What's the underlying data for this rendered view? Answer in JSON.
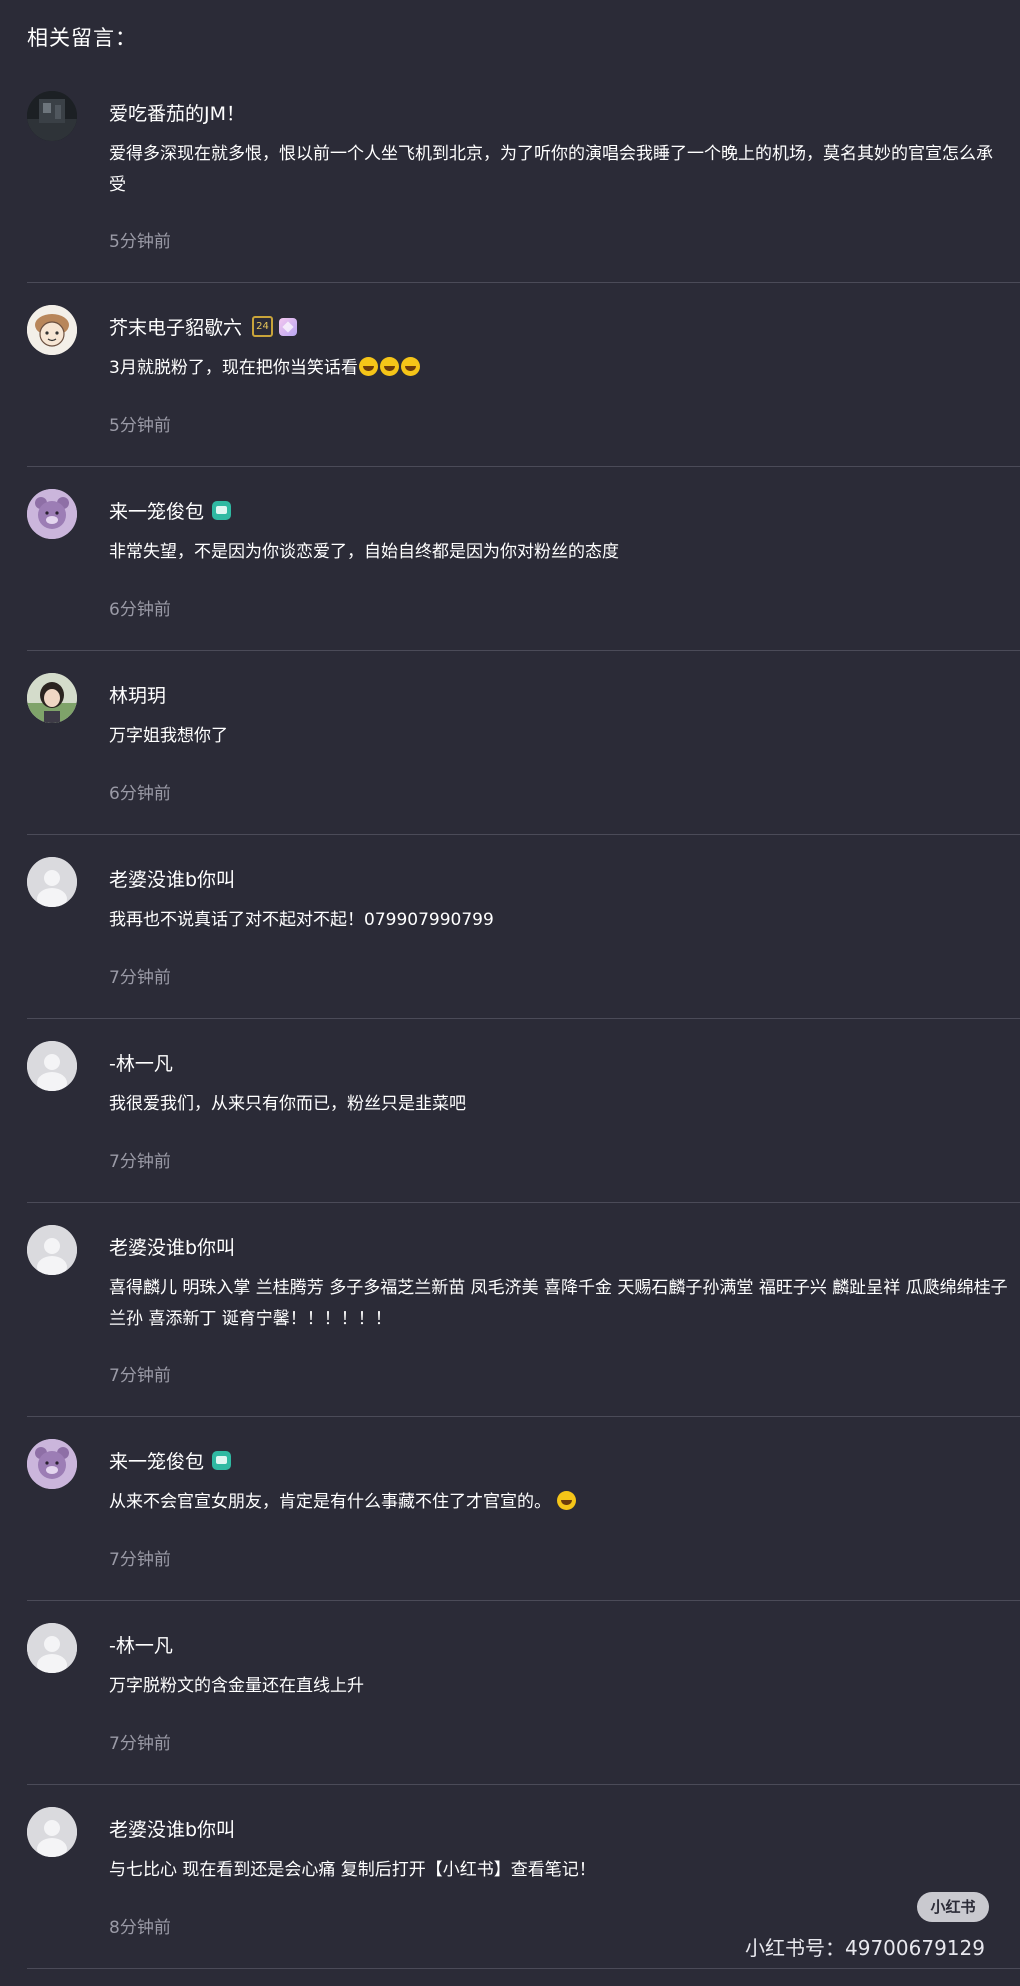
{
  "section_title": "相关留言：",
  "comments": [
    {
      "username": "爱吃番茄的JM！",
      "text": "爱得多深现在就多恨，恨以前一个人坐飞机到北京，为了听你的演唱会我睡了一个晚上的机场，莫名其妙的官宣怎么承受",
      "time": "5分钟前",
      "avatar": "dark-photo-avatar",
      "badges": []
    },
    {
      "username": "芥末电子貂歇六",
      "text": "3月就脱粉了，现在把你当笑话看",
      "time": "5分钟前",
      "avatar": "cartoon-avatar",
      "badges": [
        "24",
        "gem-icon"
      ],
      "trailing_emojis": [
        "laugh-cry-emoji",
        "laugh-cry-emoji",
        "laugh-cry-emoji"
      ]
    },
    {
      "username": "来一笼俊包",
      "text": "非常失望，不是因为你谈恋爱了，自始自终都是因为你对粉丝的态度",
      "time": "6分钟前",
      "avatar": "bear-avatar",
      "badges": [
        "chat-icon"
      ]
    },
    {
      "username": "林玥玥",
      "text": "万字姐我想你了",
      "time": "6分钟前",
      "avatar": "person-photo-avatar",
      "badges": []
    },
    {
      "username": "老婆没谁b你叫",
      "text": "我再也不说真话了对不起对不起！079907990799",
      "time": "7分钟前",
      "avatar": "default-avatar",
      "badges": []
    },
    {
      "username": "-林一凡",
      "text": "我很爱我们，从来只有你而已，粉丝只是韭菜吧",
      "time": "7分钟前",
      "avatar": "default-avatar",
      "badges": []
    },
    {
      "username": "老婆没谁b你叫",
      "text": "喜得麟儿 明珠入掌 兰桂腾芳 多子多福芝兰新苗 凤毛济美 喜降千金 天赐石麟子孙满堂 福旺子兴 麟趾呈祥 瓜瓞绵绵桂子兰孙 喜添新丁 诞育宁馨！！！！！！",
      "time": "7分钟前",
      "avatar": "default-avatar",
      "badges": []
    },
    {
      "username": "来一笼俊包",
      "text": "从来不会官宣女朋友，肯定是有什么事藏不住了才官宣的。",
      "time": "7分钟前",
      "avatar": "bear-avatar",
      "badges": [
        "chat-icon"
      ],
      "trailing_emojis": [
        "smile-emoji"
      ]
    },
    {
      "username": "-林一凡",
      "text": "万字脱粉文的含金量还在直线上升",
      "time": "7分钟前",
      "avatar": "default-avatar",
      "badges": []
    },
    {
      "username": "老婆没谁b你叫",
      "text": "与七比心 现在看到还是会心痛 复制后打开【小红书】查看笔记！",
      "time": "8分钟前",
      "avatar": "default-avatar",
      "badges": []
    }
  ],
  "watermark": {
    "logo_text": "小红书",
    "id_text": "小红书号：49700679129"
  }
}
